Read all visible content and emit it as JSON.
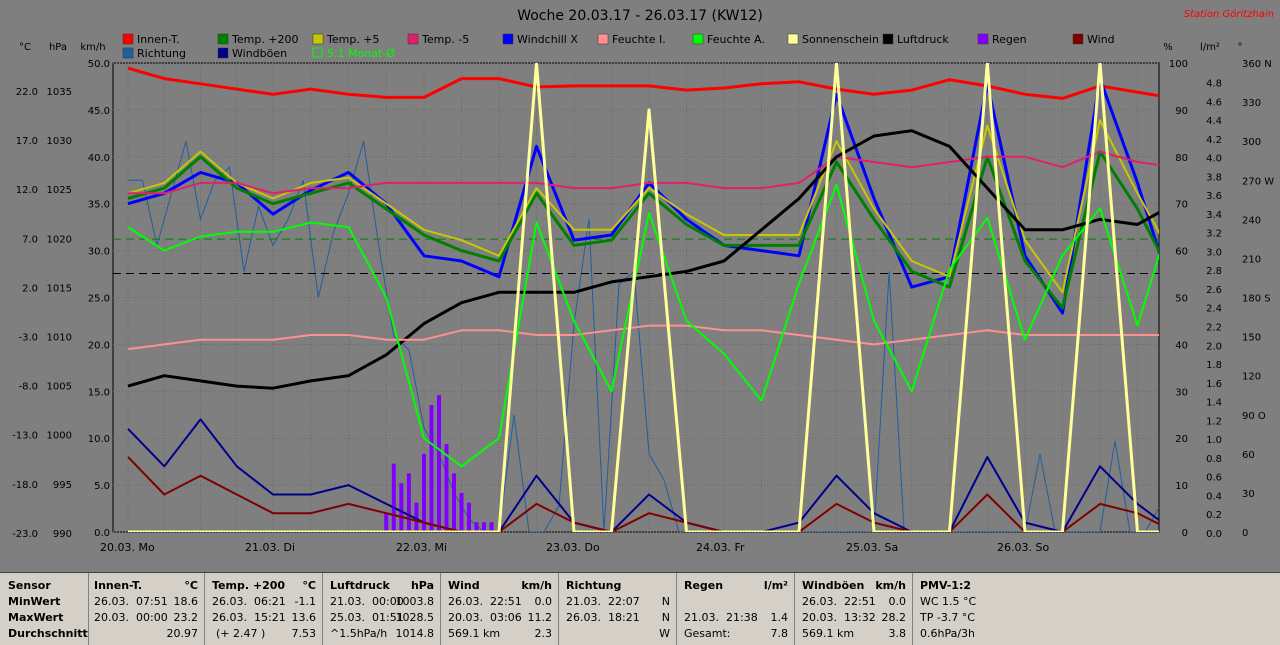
{
  "title": "Woche 20.03.17 - 26.03.17 (KW12)",
  "station": "Station Göritzhain",
  "unit_headers": {
    "c": "°C",
    "hpa": "hPa",
    "kmh": "km/h",
    "pct": "%",
    "lm2": "l/m²",
    "deg": "°"
  },
  "legend": [
    {
      "label": "Innen-T.",
      "color": "#ff0000"
    },
    {
      "label": "Richtung",
      "color": "#1f5f9f"
    },
    {
      "label": "Temp. +200",
      "color": "#008000"
    },
    {
      "label": "Windböen",
      "color": "#00008b"
    },
    {
      "label": "Temp. +5",
      "color": "#c8c800"
    },
    {
      "label": "5.1 Monat-Ø",
      "color": "#00ff00",
      "text_color": "#00ff00",
      "outline": true
    },
    {
      "label": "Temp. -5",
      "color": "#e0206e"
    },
    {
      "label": "Windchill X",
      "color": "#0000ff"
    },
    {
      "label": "Feuchte I.",
      "color": "#ff9090"
    },
    {
      "label": "Feuchte A.",
      "color": "#00ff00"
    },
    {
      "label": "Sonnenschein",
      "color": "#ffff99"
    },
    {
      "label": "Luftdruck",
      "color": "#000000"
    },
    {
      "label": "Regen",
      "color": "#8000ff"
    },
    {
      "label": "Wind",
      "color": "#800000"
    }
  ],
  "axes": {
    "temp_c": [
      "22.0",
      "17.0",
      "12.0",
      "7.0",
      "2.0",
      "-3.0",
      "-8.0",
      "-13.0",
      "-18.0",
      "-23.0"
    ],
    "pressure_hpa": [
      "1035",
      "1030",
      "1025",
      "1020",
      "1015",
      "1010",
      "1005",
      "1000",
      "995",
      "990"
    ],
    "wind_kmh": [
      "50.0",
      "45.0",
      "40.0",
      "35.0",
      "30.0",
      "25.0",
      "20.0",
      "15.0",
      "10.0",
      "5.0",
      "0.0"
    ],
    "humidity_pct": [
      "100",
      "90",
      "80",
      "70",
      "60",
      "50",
      "40",
      "30",
      "20",
      "10",
      "0"
    ],
    "rain_lm2": [
      "4.8",
      "4.6",
      "4.4",
      "4.2",
      "4.0",
      "3.8",
      "3.6",
      "3.4",
      "3.2",
      "3.0",
      "2.8",
      "2.6",
      "2.4",
      "2.2",
      "2.0",
      "1.8",
      "1.6",
      "1.4",
      "1.2",
      "1.0",
      "0.8",
      "0.6",
      "0.4",
      "0.2",
      "0.0"
    ],
    "direction": [
      "360 N",
      "330",
      "300",
      "270 W",
      "240",
      "210",
      "180 S",
      "150",
      "120",
      "90 O",
      "60",
      "30",
      "0"
    ],
    "days": [
      "20.03.  Mo",
      "21.03.  Di",
      "22.03.  Mi",
      "23.03.  Do",
      "24.03.  Fr",
      "25.03.  Sa",
      "26.03.  So"
    ]
  },
  "chart_data": {
    "type": "line",
    "title": "Woche 20.03.17 - 26.03.17 (KW12)",
    "x": [
      0,
      0.25,
      0.5,
      0.75,
      1,
      1.25,
      1.5,
      1.75,
      2,
      2.25,
      2.5,
      2.75,
      3,
      3.25,
      3.5,
      3.75,
      4,
      4.25,
      4.5,
      4.75,
      5,
      5.25,
      5.5,
      5.75,
      6,
      6.25,
      6.5,
      6.75,
      7
    ],
    "xlabel_ticks": [
      "20.03.",
      "21.03.",
      "22.03.",
      "23.03.",
      "24.03.",
      "25.03.",
      "26.03."
    ],
    "ylim_temp": [
      -23,
      22
    ],
    "ylim_pressure": [
      990,
      1035
    ],
    "ylim_wind": [
      0,
      50
    ],
    "ylim_humidity": [
      0,
      100
    ],
    "ylim_rain": [
      0,
      4.8
    ],
    "ylim_direction": [
      0,
      360
    ],
    "series": [
      {
        "name": "Innen-T.",
        "axis": "temp",
        "color": "#ff0000",
        "width": 3,
        "values": [
          21.5,
          20.5,
          20.0,
          19.5,
          19.0,
          19.5,
          19.0,
          18.7,
          18.7,
          20.5,
          20.5,
          19.7,
          19.8,
          19.8,
          19.8,
          19.4,
          19.6,
          20.0,
          20.2,
          19.5,
          19.0,
          19.4,
          20.4,
          19.8,
          19.0,
          18.6,
          19.8,
          19.2,
          18.6
        ]
      },
      {
        "name": "Windchill X",
        "axis": "temp",
        "color": "#0000ff",
        "width": 3,
        "values": [
          8.5,
          9.5,
          11.5,
          10.5,
          7.5,
          9.8,
          11.5,
          8.5,
          3.5,
          3.0,
          1.5,
          14.0,
          5.0,
          5.5,
          10.5,
          7.0,
          4.5,
          4.0,
          3.5,
          19.0,
          9.0,
          0.5,
          1.5,
          20.0,
          3.5,
          -2.0,
          20.5,
          10.5,
          -1.0
        ]
      },
      {
        "name": "Temp. +200",
        "axis": "temp",
        "color": "#008000",
        "width": 3,
        "values": [
          9.0,
          10.0,
          13.0,
          10.0,
          8.5,
          9.5,
          10.5,
          8.0,
          5.5,
          4.0,
          3.0,
          9.5,
          4.5,
          5.0,
          9.5,
          6.5,
          4.5,
          4.5,
          4.5,
          12.5,
          7.0,
          2.0,
          0.5,
          13.0,
          3.0,
          -1.5,
          13.5,
          8.0,
          1.0
        ]
      },
      {
        "name": "Temp. +5",
        "axis": "temp",
        "color": "#c8c800",
        "width": 2,
        "values": [
          9.5,
          10.5,
          13.5,
          10.5,
          9.0,
          10.5,
          11.0,
          8.5,
          6.0,
          5.0,
          3.5,
          10.0,
          6.0,
          6.0,
          10.0,
          7.5,
          5.5,
          5.5,
          5.5,
          14.5,
          8.0,
          3.0,
          1.5,
          16.0,
          5.0,
          0.0,
          16.5,
          9.5,
          3.0
        ]
      },
      {
        "name": "Temp. -5",
        "axis": "temp",
        "color": "#e0206e",
        "width": 2,
        "values": [
          9.5,
          9.5,
          10.5,
          10.5,
          9.5,
          10.0,
          10.0,
          10.5,
          10.5,
          10.5,
          10.5,
          10.5,
          10.0,
          10.0,
          10.5,
          10.5,
          10.0,
          10.0,
          10.5,
          13.0,
          12.5,
          12.0,
          12.5,
          13.0,
          13.0,
          12.0,
          13.5,
          12.5,
          12.0
        ]
      },
      {
        "name": "Luftdruck",
        "axis": "pressure",
        "color": "#000000",
        "width": 3,
        "values": [
          1004,
          1005,
          1004.5,
          1004,
          1003.8,
          1004.5,
          1005,
          1007,
          1010,
          1012,
          1013,
          1013,
          1013,
          1014,
          1014.5,
          1015,
          1016,
          1019,
          1022,
          1026,
          1028,
          1028.5,
          1027,
          1023,
          1019,
          1019,
          1020,
          1019.5,
          1021.5
        ]
      },
      {
        "name": "Feuchte I.",
        "axis": "humidity",
        "color": "#ff9090",
        "width": 2,
        "values": [
          39,
          40,
          41,
          41,
          41,
          42,
          42,
          41,
          41,
          43,
          43,
          42,
          42,
          43,
          44,
          44,
          43,
          43,
          42,
          41,
          40,
          41,
          42,
          43,
          42,
          42,
          42,
          42,
          42
        ]
      },
      {
        "name": "Feuchte A.",
        "axis": "humidity",
        "color": "#00ff00",
        "width": 2,
        "values": [
          65,
          60,
          63,
          64,
          64,
          66,
          65,
          50,
          20,
          14,
          20,
          66,
          45,
          30,
          68,
          45,
          38,
          28,
          53,
          74,
          45,
          30,
          56,
          67,
          41,
          59,
          69,
          44,
          70
        ]
      },
      {
        "name": "Windböen",
        "axis": "wind",
        "color": "#00008b",
        "width": 2,
        "values": [
          11,
          7,
          12,
          7,
          4,
          4,
          5,
          3,
          1,
          0,
          0,
          6,
          1,
          0,
          4,
          1,
          0,
          0,
          1,
          6,
          2,
          0,
          0,
          8,
          1,
          0,
          7,
          3,
          0
        ]
      },
      {
        "name": "Wind",
        "axis": "wind",
        "color": "#800000",
        "width": 2,
        "values": [
          8,
          4,
          6,
          4,
          2,
          2,
          3,
          2,
          1,
          0,
          0,
          3,
          1,
          0,
          2,
          1,
          0,
          0,
          0,
          3,
          1,
          0,
          0,
          4,
          0,
          0,
          3,
          2,
          0
        ]
      },
      {
        "name": "Sonnenschein",
        "axis": "humidity",
        "color": "#ffff99",
        "width": 3,
        "values": [
          0,
          0,
          0,
          0,
          0,
          0,
          0,
          0,
          0,
          0,
          0,
          100,
          0,
          0,
          90,
          0,
          0,
          0,
          0,
          100,
          0,
          0,
          0,
          100,
          0,
          0,
          100,
          0,
          0
        ]
      }
    ],
    "reference_lines": [
      {
        "name": "5.1 Monat-Ø",
        "axis": "temp",
        "value": 5.1,
        "color": "#008000"
      },
      {
        "name": "Luftdruck-Ø",
        "axis": "pressure",
        "value": 1014.8,
        "color": "#000000"
      }
    ],
    "rain_bars": {
      "axis": "rain",
      "color": "#8000ff",
      "x": [
        1.75,
        1.8,
        1.85,
        1.9,
        1.95,
        2.0,
        2.05,
        2.1,
        2.15,
        2.2,
        2.25,
        2.3,
        2.35,
        2.4,
        2.45
      ],
      "values": [
        0.2,
        0.7,
        0.5,
        0.6,
        0.3,
        0.8,
        1.3,
        1.4,
        0.9,
        0.6,
        0.4,
        0.3,
        0.1,
        0.1,
        0.1
      ]
    },
    "direction_series": {
      "name": "Richtung",
      "axis": "direction",
      "color": "#1f5f9f",
      "x": [
        0,
        0.1,
        0.2,
        0.3,
        0.4,
        0.5,
        0.6,
        0.7,
        0.8,
        0.9,
        1.0,
        1.1,
        1.2,
        1.3,
        1.4,
        1.5,
        1.6,
        1.7,
        1.8,
        1.9,
        2.0,
        2.1,
        2.2,
        2.3,
        2.4,
        2.5,
        2.6,
        2.7,
        2.8,
        2.9,
        3.0,
        3.1,
        3.2,
        3.3,
        3.4,
        3.5,
        3.6,
        3.7,
        3.8,
        3.9,
        4.0,
        4.1,
        4.2,
        4.3,
        4.4,
        4.5,
        4.6,
        4.7,
        4.8,
        4.9,
        5.0,
        5.1,
        5.2,
        5.3,
        5.4,
        5.5,
        5.6,
        5.7,
        5.8,
        5.9,
        6.0,
        6.1,
        6.2,
        6.3,
        6.4,
        6.5,
        6.6,
        6.7,
        6.8,
        6.9,
        7.0
      ],
      "values": [
        270,
        270,
        220,
        260,
        300,
        240,
        270,
        280,
        200,
        250,
        220,
        240,
        270,
        180,
        230,
        260,
        300,
        220,
        150,
        140,
        80,
        60,
        30,
        10,
        0,
        0,
        90,
        0,
        0,
        20,
        160,
        240,
        0,
        190,
        200,
        60,
        40,
        0,
        0,
        0,
        0,
        0,
        0,
        0,
        0,
        0,
        0,
        0,
        0,
        0,
        0,
        200,
        0,
        0,
        0,
        0,
        0,
        0,
        0,
        0,
        0,
        60,
        0,
        0,
        0,
        0,
        70,
        0,
        0,
        20,
        0
      ]
    }
  },
  "stats": {
    "sensor": {
      "label": "Sensor",
      "min": "MinWert",
      "max": "MaxWert",
      "avg": "Durchschnitt"
    },
    "innen": {
      "title": "Innen-T.",
      "unit": "°C",
      "min_d": "26.03.",
      "min_t": "07:51",
      "min_v": "18.6",
      "max_d": "20.03.",
      "max_t": "00:00",
      "max_v": "23.2",
      "avg_v": "20.97"
    },
    "temp200": {
      "title": "Temp. +200",
      "unit": "°C",
      "min_d": "26.03.",
      "min_t": "06:21",
      "min_v": "-1.1",
      "max_d": "26.03.",
      "max_t": "15:21",
      "max_v": "13.6",
      "avg_note": "(+ 2.47 )",
      "avg_v": "7.53"
    },
    "luftdruck": {
      "title": "Luftdruck",
      "unit": "hPa",
      "min_d": "21.03.",
      "min_t": "00:00",
      "min_v": "1003.8",
      "max_d": "25.03.",
      "max_t": "01:51",
      "max_v": "1028.5",
      "avg_note": "^1.5hPa/h",
      "avg_v": "1014.8"
    },
    "wind": {
      "title": "Wind",
      "unit": "km/h",
      "min_d": "26.03.",
      "min_t": "22:51",
      "min_v": "0.0",
      "max_d": "20.03.",
      "max_t": "03:06",
      "max_v": "11.2",
      "avg_note": "569.1 km",
      "avg_v": "2.3"
    },
    "richtung": {
      "title": "Richtung",
      "min_d": "21.03.",
      "min_t": "22:07",
      "min_v": "N",
      "max_d": "26.03.",
      "max_t": "18:21",
      "max_v": "N",
      "avg_v": "W"
    },
    "regen": {
      "title": "Regen",
      "unit": "l/m²",
      "max_d": "21.03.",
      "max_t": "21:38",
      "max_v": "1.4",
      "total_label": "Gesamt:",
      "total_v": "7.8"
    },
    "boeen": {
      "title": "Windböen",
      "unit": "km/h",
      "min_d": "26.03.",
      "min_t": "22:51",
      "min_v": "0.0",
      "max_d": "20.03.",
      "max_t": "13:32",
      "max_v": "28.2",
      "avg_note": "569.1 km",
      "avg_v": "3.8"
    },
    "pmv": {
      "title": "PMV-1:2",
      "l1": "WC 1.5 °C",
      "l2": "TP -3.7 °C",
      "l3": "0.6hPa/3h"
    }
  }
}
